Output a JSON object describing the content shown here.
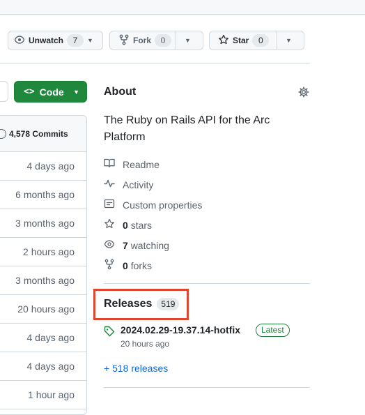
{
  "repo_actions": {
    "unwatch_label": "Unwatch",
    "unwatch_count": "7",
    "fork_label": "Fork",
    "fork_count": "0",
    "star_label": "Star",
    "star_count": "0"
  },
  "code_button": {
    "label": "Code"
  },
  "file_list": {
    "commits_label": "4,578 Commits",
    "rows": [
      "4 days ago",
      "6 months ago",
      "3 months ago",
      "2 hours ago",
      "3 months ago",
      "20 hours ago",
      "4 days ago",
      "4 days ago",
      "1 hour ago"
    ]
  },
  "about": {
    "title": "About",
    "description": "The Ruby on Rails API for the Arc Platform",
    "readme": "Readme",
    "activity": "Activity",
    "custom_properties": "Custom properties",
    "stars_count": "0",
    "stars_label": "stars",
    "watching_count": "7",
    "watching_label": "watching",
    "forks_count": "0",
    "forks_label": "forks"
  },
  "releases": {
    "title": "Releases",
    "count": "519",
    "latest_name": "2024.02.29-19.37.14-hotfix",
    "latest_badge": "Latest",
    "latest_time": "20 hours ago",
    "more_link": "+ 518 releases"
  },
  "colors": {
    "accent_green": "#1f883d",
    "link_blue": "#0969da",
    "highlight_red": "#e0452e"
  }
}
